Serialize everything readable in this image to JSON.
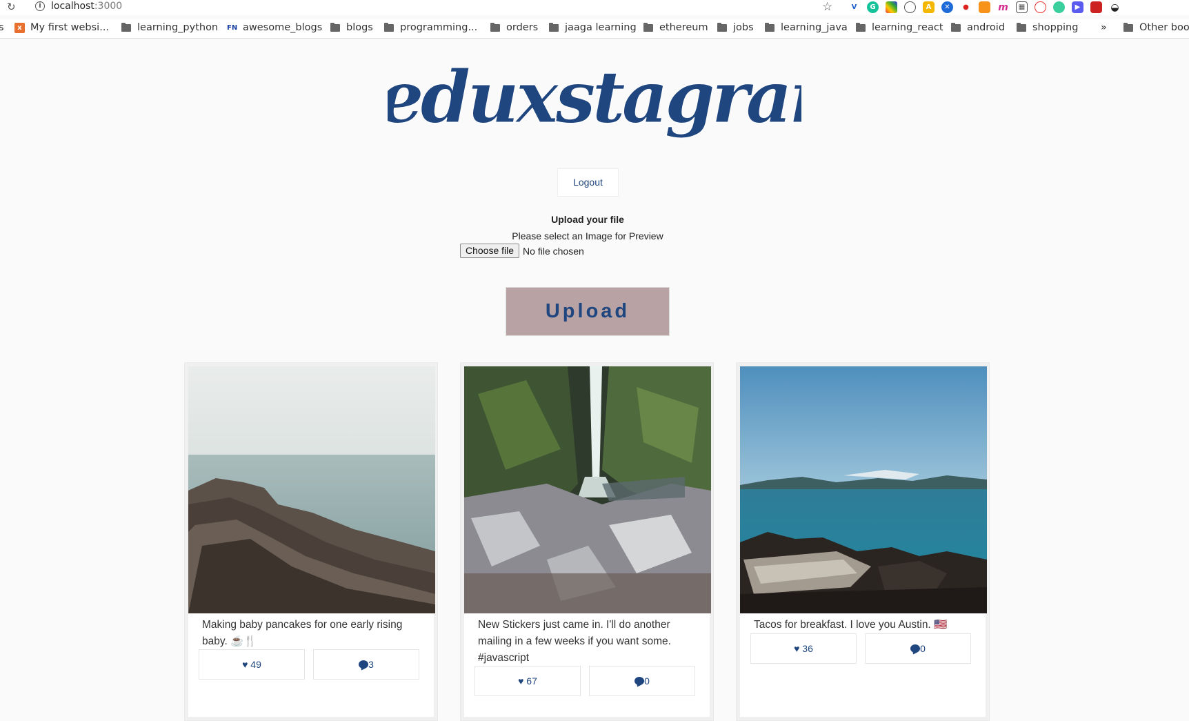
{
  "browser": {
    "url_host": "localhost",
    "url_port": ":3000",
    "bookmarks": [
      {
        "label": "s",
        "icon": "none"
      },
      {
        "label": "My first websi...",
        "icon": "site-x"
      },
      {
        "label": "learning_python",
        "icon": "folder"
      },
      {
        "label": "awesome_blogs",
        "icon": "site-fn"
      },
      {
        "label": "blogs",
        "icon": "folder"
      },
      {
        "label": "programming...",
        "icon": "folder"
      },
      {
        "label": "orders",
        "icon": "folder"
      },
      {
        "label": "jaaga learning",
        "icon": "folder"
      },
      {
        "label": "ethereum",
        "icon": "folder"
      },
      {
        "label": "jobs",
        "icon": "folder"
      },
      {
        "label": "learning_java",
        "icon": "folder"
      },
      {
        "label": "learning_react",
        "icon": "folder"
      },
      {
        "label": "android",
        "icon": "folder"
      },
      {
        "label": "shopping",
        "icon": "folder"
      },
      {
        "label": "»",
        "icon": "none"
      },
      {
        "label": "Other boo",
        "icon": "folder"
      }
    ]
  },
  "app": {
    "logo_text": "Reduxstagram",
    "logout_label": "Logout",
    "upload_title": "Upload your file",
    "upload_hint": "Please select an Image for Preview",
    "choose_file_label": "Choose file",
    "file_status": "No file chosen",
    "upload_label": "Upload",
    "brand_color": "#20467f",
    "upload_bg": "#b8a2a3"
  },
  "posts": [
    {
      "caption": "Making baby pancakes for one early rising baby. ☕🍴",
      "likes": "♥ 49",
      "comments": "3",
      "photo": "rocky-shore-fog"
    },
    {
      "caption": "New Stickers just came in. I'll do another mailing in a few weeks if you want some. #javascript",
      "likes": "♥ 67",
      "comments": "0",
      "photo": "forest-waterfall"
    },
    {
      "caption": "Tacos for breakfast. I love you Austin. 🇺🇸",
      "likes": "♥ 36",
      "comments": "0",
      "photo": "blue-sea-rocks"
    }
  ]
}
